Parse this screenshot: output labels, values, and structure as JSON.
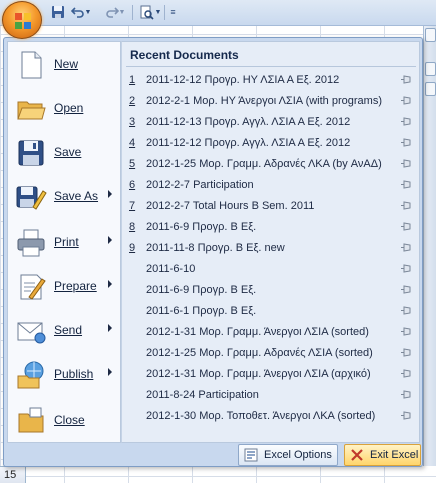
{
  "toolbar": {
    "office_button_icon": "office-logo-icon",
    "icons": [
      "save-icon",
      "undo-icon",
      "redo-icon",
      "print-preview-icon",
      "customize-icon"
    ]
  },
  "menu": {
    "commands": [
      {
        "label": "New",
        "icon": "new-document-icon",
        "submenu": false
      },
      {
        "label": "Open",
        "icon": "open-folder-icon",
        "submenu": false
      },
      {
        "label": "Save",
        "icon": "floppy-disk-icon",
        "submenu": false
      },
      {
        "label": "Save As",
        "icon": "save-as-icon",
        "submenu": true
      },
      {
        "label": "Print",
        "icon": "printer-icon",
        "submenu": true
      },
      {
        "label": "Prepare",
        "icon": "prepare-icon",
        "submenu": true
      },
      {
        "label": "Send",
        "icon": "send-icon",
        "submenu": true
      },
      {
        "label": "Publish",
        "icon": "publish-icon",
        "submenu": true
      },
      {
        "label": "Close",
        "icon": "close-folder-icon",
        "submenu": false
      }
    ],
    "recent_title": "Recent Documents",
    "recent": [
      {
        "num": "1",
        "name": "2011-12-12 Προγρ. ΗΥ ΛΣΙΑ Α Εξ. 2012"
      },
      {
        "num": "2",
        "name": "2012-2-1 Μορ. ΗΥ Άνεργοι ΛΣΙΑ (with programs)"
      },
      {
        "num": "3",
        "name": "2011-12-13 Προγρ. Αγγλ. ΛΣΙΑ Α Εξ. 2012"
      },
      {
        "num": "4",
        "name": "2011-12-12 Προγρ. Αγγλ. ΛΣΙΑ Α Εξ. 2012"
      },
      {
        "num": "5",
        "name": "2012-1-25 Μορ. Γραμμ. Αδρανές ΛΚΑ (by ΑνΑΔ)"
      },
      {
        "num": "6",
        "name": "2012-2-7 Participation"
      },
      {
        "num": "7",
        "name": "2012-2-7 Total Hours B Sem. 2011"
      },
      {
        "num": "8",
        "name": "2011-6-9 Προγρ. Β Εξ."
      },
      {
        "num": "9",
        "name": "2011-11-8 Προγρ. Β Εξ. new"
      },
      {
        "num": "",
        "name": "2011-6-10"
      },
      {
        "num": "",
        "name": "2011-6-9 Προγρ. Β Εξ."
      },
      {
        "num": "",
        "name": "2011-6-1 Προγρ. Β Εξ."
      },
      {
        "num": "",
        "name": "2012-1-31 Μορ. Γραμμ. Άνεργοι ΛΣΙΑ (sorted)"
      },
      {
        "num": "",
        "name": "2012-1-25 Μορ. Γραμμ. Αδρανές ΛΣΙΑ (sorted)"
      },
      {
        "num": "",
        "name": "2012-1-31 Μορ. Γραμμ. Άνεργοι ΛΣΙΑ (αρχικό)"
      },
      {
        "num": "",
        "name": "2011-8-24 Participation"
      },
      {
        "num": "",
        "name": "2012-1-30 Μορ. Τοποθετ. Άνεργοι ΛΚΑ (sorted)"
      }
    ],
    "pin_icon": "pin-icon",
    "options_label": "Excel Options",
    "exit_label": "Exit Excel"
  },
  "sheet": {
    "row_number": "15"
  },
  "colors": {
    "menu_frame": "#c8d8ee",
    "recent_bg": "#e6edf7",
    "exit_highlight": "#ffd56b"
  }
}
